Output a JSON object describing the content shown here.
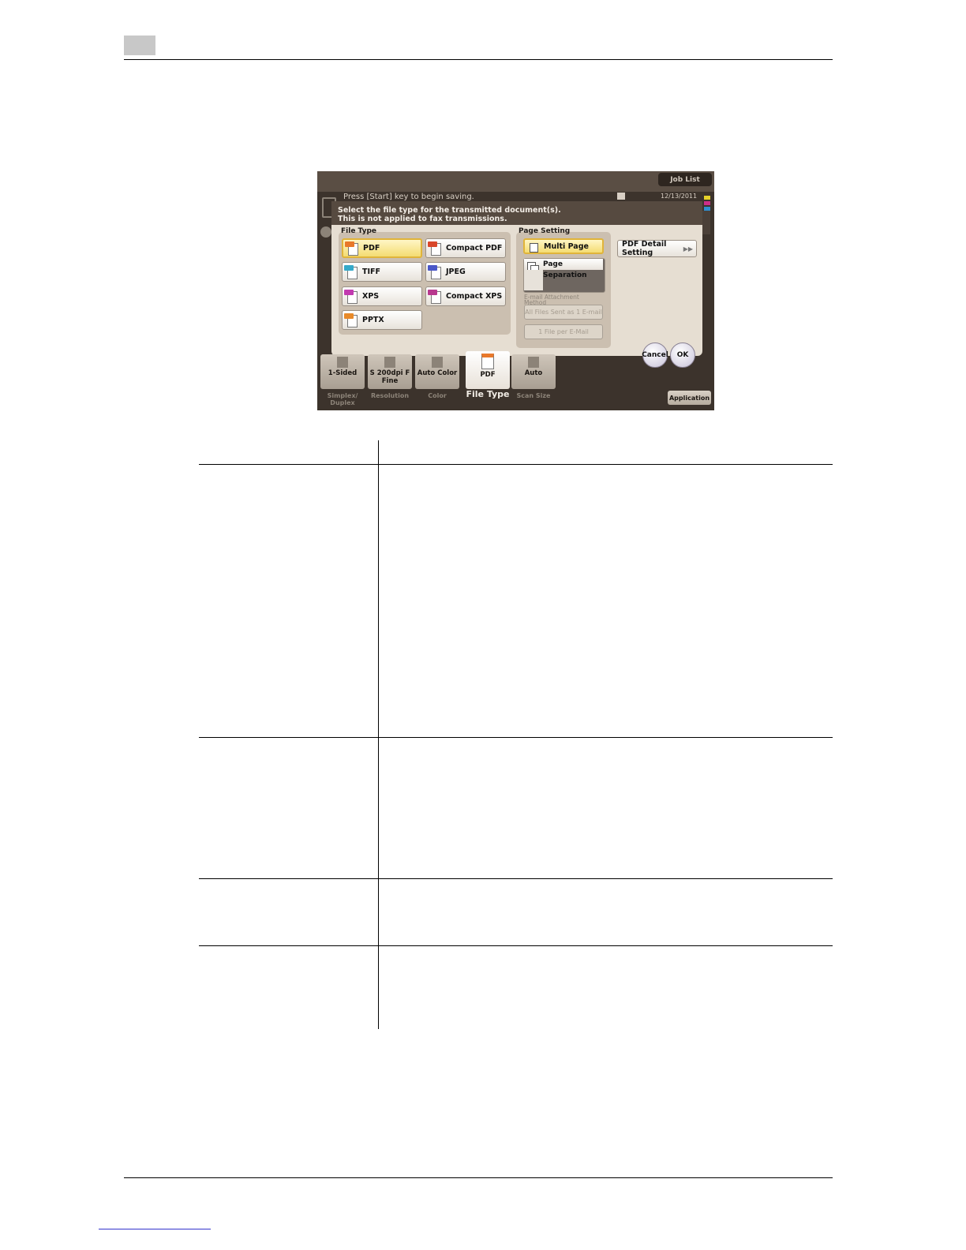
{
  "screen": {
    "job_list": "Job List",
    "status_message": "Press [Start] key to begin saving.",
    "clock": "12/13/2011",
    "instructions_line1": "Select the file type for the transmitted document(s).",
    "instructions_line2": "This is not applied to fax transmissions.",
    "file_type_group": {
      "label": "File Type",
      "options": [
        {
          "label": "PDF",
          "tag": "PDF",
          "color": "#e8782a",
          "selected": true
        },
        {
          "label": "Compact PDF",
          "tag": "PDF",
          "color": "#d9472b",
          "selected": false
        },
        {
          "label": "TIFF",
          "tag": "TIFF",
          "color": "#35a9c9",
          "selected": false
        },
        {
          "label": "JPEG",
          "tag": "JPEG",
          "color": "#4a57c8",
          "selected": false
        },
        {
          "label": "XPS",
          "tag": "XPS",
          "color": "#c23ab0",
          "selected": false
        },
        {
          "label": "Compact XPS",
          "tag": "XPS",
          "color": "#b8388e",
          "selected": false
        },
        {
          "label": "PPTX",
          "tag": "PPTX",
          "color": "#e88a2a",
          "selected": false
        }
      ]
    },
    "page_setting_group": {
      "label": "Page Setting",
      "multi_page": "Multi Page",
      "page_separation": "Page Separation",
      "attachment_label": "E-mail Attachment Method",
      "all_files": "All Files Sent as 1 E-mail",
      "one_file": "1 File per E-Mail"
    },
    "pdf_detail_setting": "PDF Detail Setting",
    "cancel": "Cancel",
    "ok": "OK",
    "bottom_tiles": [
      {
        "value": "1-Sided",
        "label": "Simplex/ Duplex"
      },
      {
        "value": "S 200dpi F Fine",
        "label": "Resolution"
      },
      {
        "value": "Auto Color",
        "label": "Color"
      },
      {
        "value": "PDF",
        "label": "File Type"
      },
      {
        "value": "Auto",
        "label": "Scan Size"
      }
    ],
    "application": "Application"
  }
}
